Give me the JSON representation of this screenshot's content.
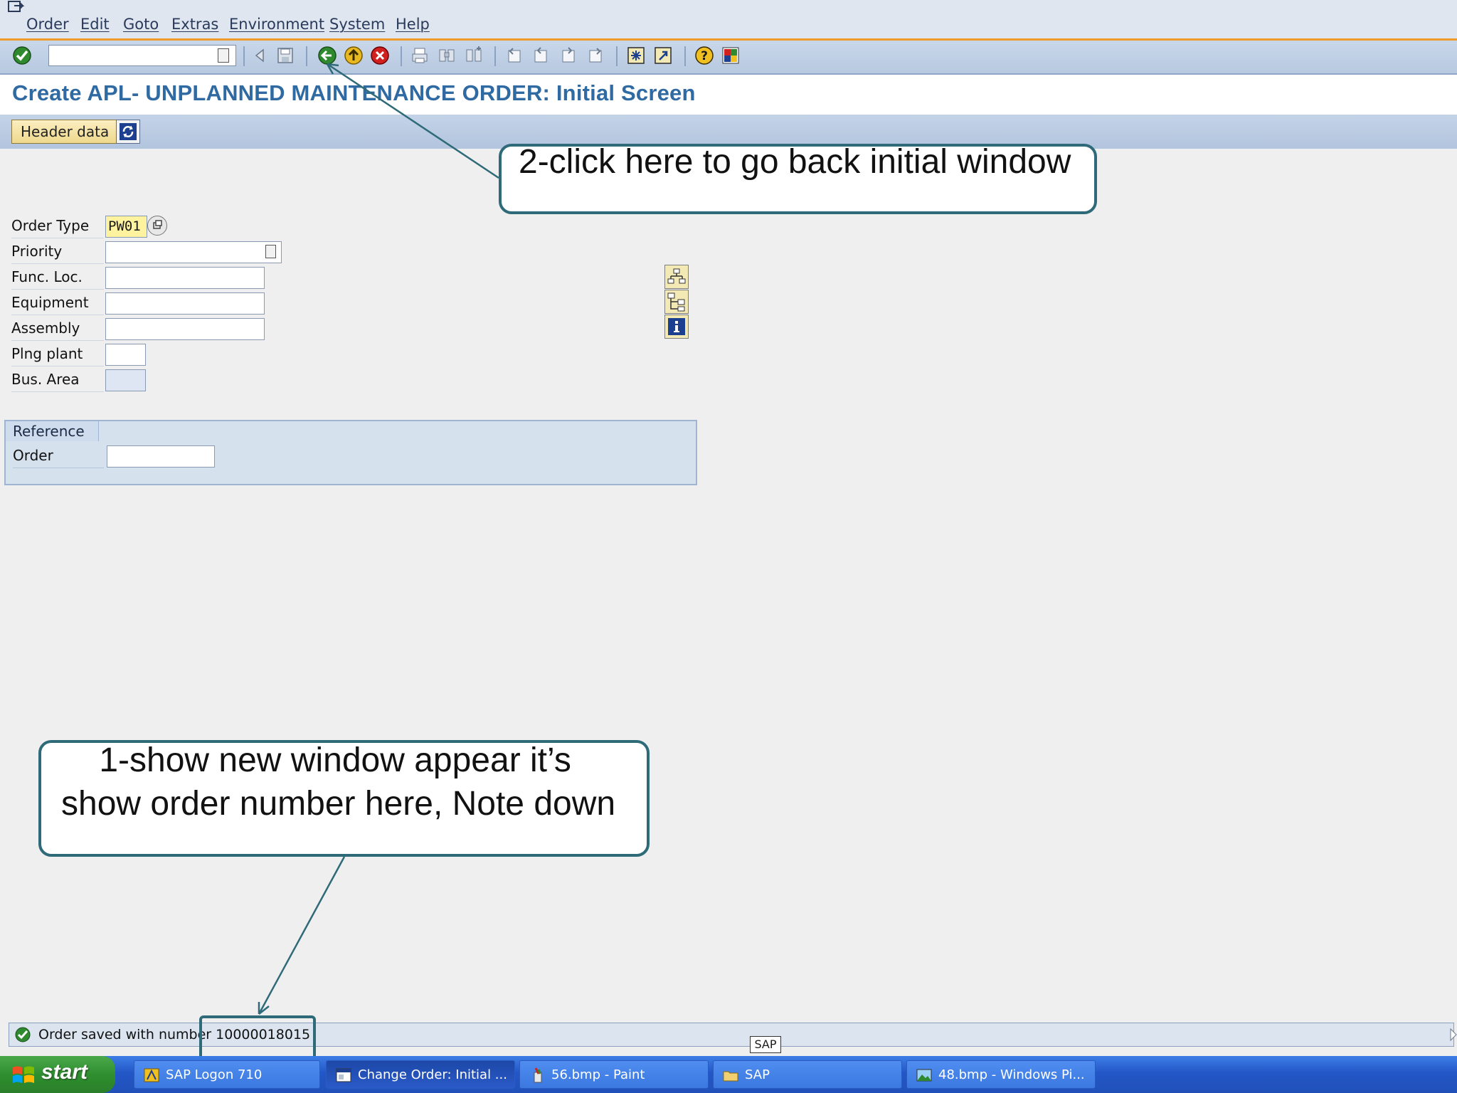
{
  "menu": {
    "items": [
      {
        "label": "Order"
      },
      {
        "label": "Edit"
      },
      {
        "label": "Goto"
      },
      {
        "label": "Extras"
      },
      {
        "label": "Environment"
      },
      {
        "label": "System"
      },
      {
        "label": "Help"
      }
    ]
  },
  "toolbar": {
    "command_field_value": "",
    "icons": [
      "enter-icon",
      "back-nav-icon",
      "save-icon",
      "back-icon",
      "exit-icon",
      "cancel-icon",
      "print-icon",
      "find-icon",
      "find-next-icon",
      "first-page-icon",
      "previous-page-icon",
      "next-page-icon",
      "last-page-icon",
      "create-session-icon",
      "shortcut-icon",
      "help-icon",
      "layout-menu-icon"
    ]
  },
  "page": {
    "title": "Create APL- UNPLANNED MAINTENANCE ORDER: Initial Screen"
  },
  "app_toolbar": {
    "header_data_label": "Header data"
  },
  "form": {
    "order_type_label": "Order Type",
    "order_type_value": "PW01",
    "priority_label": "Priority",
    "priority_value": "",
    "func_loc_label": "Func. Loc.",
    "func_loc_value": "",
    "equipment_label": "Equipment",
    "equipment_value": "",
    "assembly_label": "Assembly",
    "assembly_value": "",
    "plng_plant_label": "Plng plant",
    "plng_plant_value": "",
    "bus_area_label": "Bus. Area",
    "bus_area_value": ""
  },
  "reference": {
    "title": "Reference",
    "order_label": "Order",
    "order_value": ""
  },
  "callouts": {
    "back_hint": "2-click here to go back initial window",
    "order_hint": "    1-show new window appear it’s show order number here, Note down"
  },
  "status": {
    "message": "Order saved with number 10000018015",
    "sap_tag": "SAP"
  },
  "taskbar": {
    "start_label": "start",
    "tasks": [
      {
        "label": "SAP Logon 710"
      },
      {
        "label": "Change Order: Initial ..."
      },
      {
        "label": "56.bmp - Paint"
      },
      {
        "label": "SAP"
      },
      {
        "label": "48.bmp - Windows Pi..."
      }
    ]
  },
  "colors": {
    "title_blue": "#2f6aa3",
    "callout_border": "#2e6a78",
    "menu_accent": "#f09a2a",
    "taskbar_blue": "#2357c7",
    "start_green": "#2f8f2f"
  }
}
